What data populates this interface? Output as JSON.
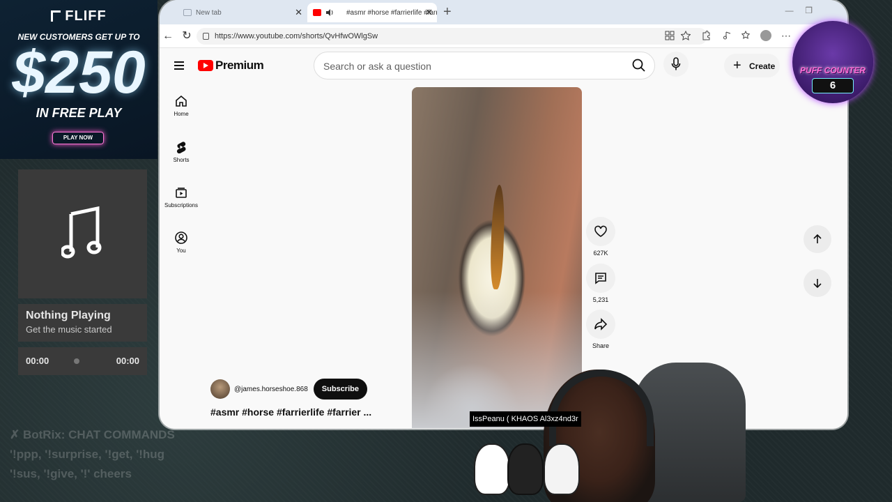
{
  "ad": {
    "brand": "FLIFF",
    "line1": "NEW CUSTOMERS GET UP TO",
    "amount": "$250",
    "line2": "IN FREE PLAY",
    "cta": "PLAY NOW"
  },
  "music": {
    "title": "Nothing Playing",
    "subtitle": "Get the music started",
    "time_current": "00:00",
    "time_total": "00:00"
  },
  "chat": {
    "line1": "✗ BotRix: CHAT COMMANDS",
    "line2": "'!ppp, '!surprise, '!get, '!hug",
    "line3": "'!sus, '!give, '!' cheers"
  },
  "browser": {
    "tabs": [
      {
        "label": "New tab",
        "active": false
      },
      {
        "label": "#asmr #horse #farrierlife #farr",
        "active": true
      }
    ],
    "url": "https://www.youtube.com/shorts/QvHfwOWlgSw"
  },
  "youtube": {
    "logo_text": "Premium",
    "search_placeholder": "Search or ask a question",
    "create_label": "Create",
    "sidebar": [
      {
        "label": "Home",
        "icon": "home-icon"
      },
      {
        "label": "Shorts",
        "icon": "shorts-icon"
      },
      {
        "label": "Subscriptions",
        "icon": "subscriptions-icon"
      },
      {
        "label": "You",
        "icon": "you-icon"
      }
    ],
    "actions": {
      "likes": "627K",
      "comments": "5,231",
      "share": "Share"
    },
    "channel": {
      "handle": "@james.horseshoe.868",
      "subscribe_label": "Subscribe"
    },
    "caption": "#asmr #horse #farrierlife #farrier ..."
  },
  "overlay": {
    "puff_label": "PUFF COUNTER",
    "puff_count": "6",
    "namebar": "IssPeanu ( KHAOS  Al3xz4nd3r"
  },
  "colors": {
    "yt_red": "#ff0000",
    "subscribe_bg": "#0f0f0f",
    "tab_active": "#ffffff"
  }
}
